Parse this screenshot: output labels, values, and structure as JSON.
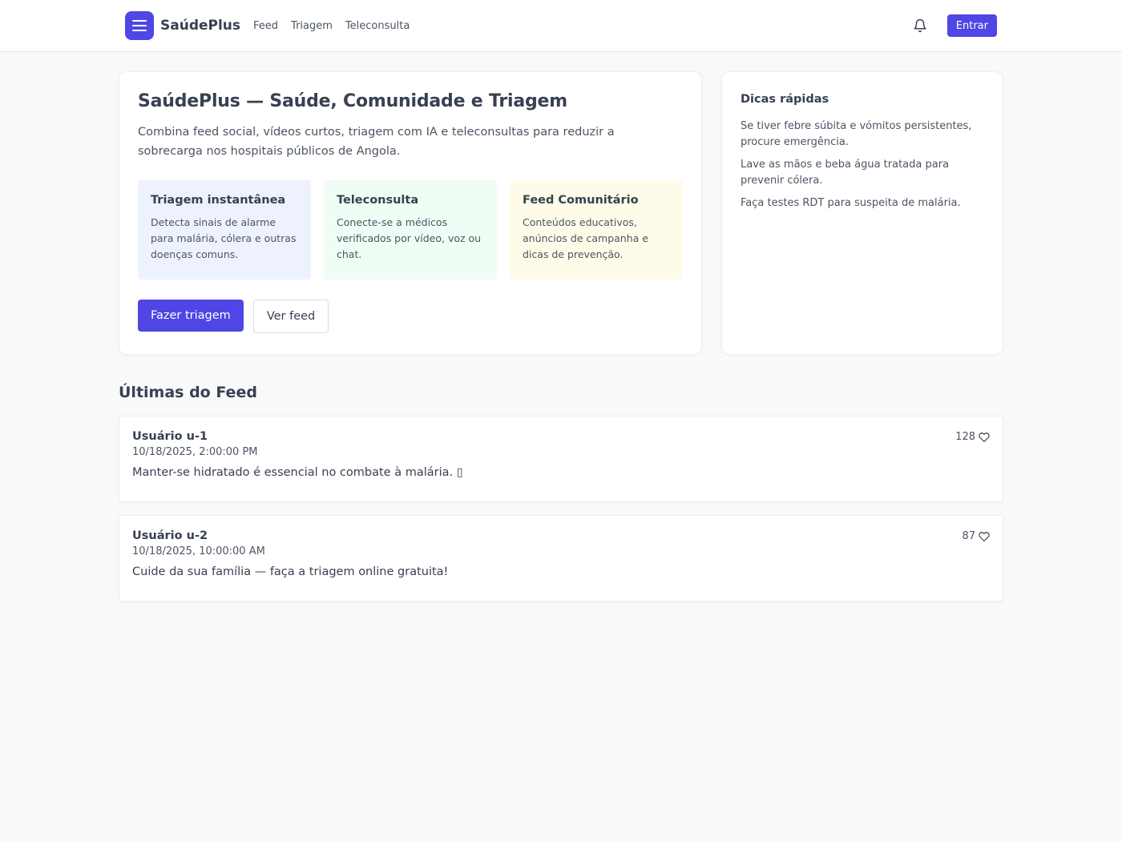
{
  "header": {
    "brand": "SaúdePlus",
    "nav": [
      "Feed",
      "Triagem",
      "Teleconsulta"
    ],
    "login_label": "Entrar"
  },
  "hero": {
    "title": "SaúdePlus — Saúde, Comunidade e Triagem",
    "subtitle": "Combina feed social, vídeos curtos, triagem com IA e teleconsultas para reduzir a sobrecarga nos hospitais públicos de Angola.",
    "features": [
      {
        "title": "Triagem instantânea",
        "desc": "Detecta sinais de alarme para malária, cólera e outras doenças comuns.",
        "bg": "#eef2ff"
      },
      {
        "title": "Teleconsulta",
        "desc": "Conecte-se a médicos verificados por vídeo, voz ou chat.",
        "bg": "#f0fdf4"
      },
      {
        "title": "Feed Comunitário",
        "desc": "Conteúdos educativos, anúncios de campanha e dicas de prevenção.",
        "bg": "#fefce8"
      }
    ],
    "primary_cta": "Fazer triagem",
    "secondary_cta": "Ver feed"
  },
  "tips": {
    "title": "Dicas rápidas",
    "items": [
      "Se tiver febre súbita e vómitos persistentes, procure emergência.",
      "Lave as mãos e beba água tratada para prevenir cólera.",
      "Faça testes RDT para suspeita de malária."
    ]
  },
  "feed": {
    "heading": "Últimas do Feed",
    "posts": [
      {
        "user": "Usuário u-1",
        "time": "10/18/2025, 2:00:00 PM",
        "text": "Manter-se hidratado é essencial no combate à malária. ▯",
        "likes": "128"
      },
      {
        "user": "Usuário u-2",
        "time": "10/18/2025, 10:00:00 AM",
        "text": "Cuide da sua família — faça a triagem online gratuita!",
        "likes": "87"
      }
    ]
  },
  "colors": {
    "accent": "#4f46e5",
    "background": "#f8f9fb"
  },
  "icons": {
    "logo": "menu-icon",
    "notifications": "bell-icon",
    "like": "heart-icon"
  }
}
